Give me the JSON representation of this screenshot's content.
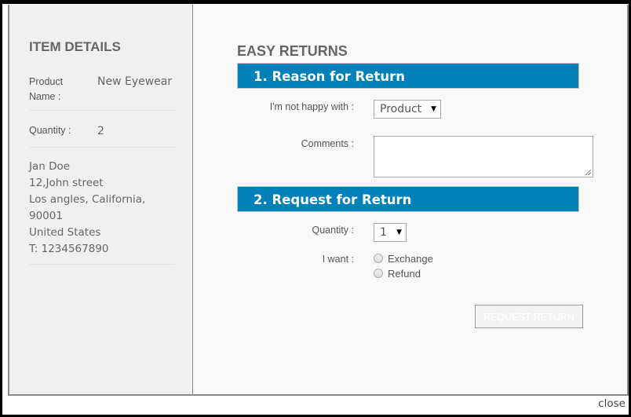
{
  "sidebar": {
    "title": "ITEM DETAILS",
    "product_label_1": "Product",
    "product_label_2": "Name :",
    "product_value": "New Eyewear",
    "quantity_label": "Quantity :",
    "quantity_value": "2",
    "address": [
      "Jan Doe",
      "12,John street",
      "Los angles, California,",
      "90001",
      "United States",
      "T: 1234567890"
    ]
  },
  "main": {
    "title": "EASY RETURNS",
    "section1": {
      "heading": "1. Reason for Return",
      "reason_label": "I'm not happy with :",
      "reason_selected": "Product",
      "comments_label": "Comments :",
      "comments_value": ""
    },
    "section2": {
      "heading": "2. Request for Return",
      "quantity_label": "Quantity :",
      "quantity_selected": "1",
      "want_label": "I want :",
      "options": [
        "Exchange",
        "Refund"
      ]
    },
    "submit_label": "REQUEST RETURN"
  },
  "close_label": "close",
  "colors": {
    "accent": "#0280b8"
  }
}
